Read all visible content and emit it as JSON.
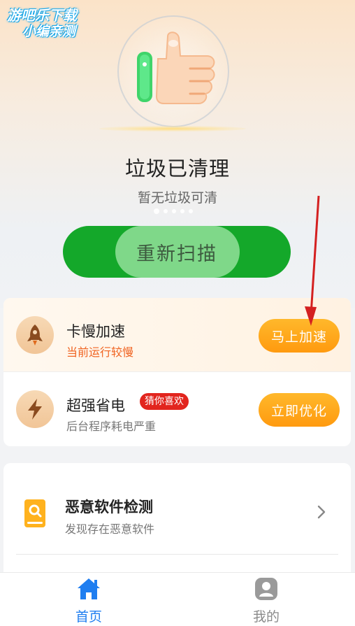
{
  "watermark": {
    "line1": "游吧乐下载",
    "line2": "小编亲测"
  },
  "status": {
    "title": "垃圾已清理",
    "subtitle": "暂无垃圾可清",
    "page_dots": 5,
    "active_dot": 0
  },
  "rescan_button": "重新扫描",
  "optimize_list": [
    {
      "icon": "rocket-icon",
      "title": "卡慢加速",
      "subtitle": "当前运行较慢",
      "action": "马上加速"
    },
    {
      "icon": "lightning-icon",
      "title": "超强省电",
      "badge": "猜你喜欢",
      "subtitle": "后台程序耗电严重",
      "action": "立即优化"
    }
  ],
  "feature_list": [
    {
      "icon": "phone-search-icon",
      "title": "恶意软件检测",
      "subtitle": "发现存在恶意软件"
    }
  ],
  "tabbar": {
    "items": [
      {
        "icon": "home-icon",
        "label": "首页",
        "active": true
      },
      {
        "icon": "user-icon",
        "label": "我的",
        "active": false
      }
    ]
  },
  "colors": {
    "primary_green": "#14a82a",
    "action_orange": "#ff9a0f",
    "badge_red": "#e2251e",
    "tab_active_blue": "#1f7ef0",
    "annotation_red": "#d42020"
  }
}
